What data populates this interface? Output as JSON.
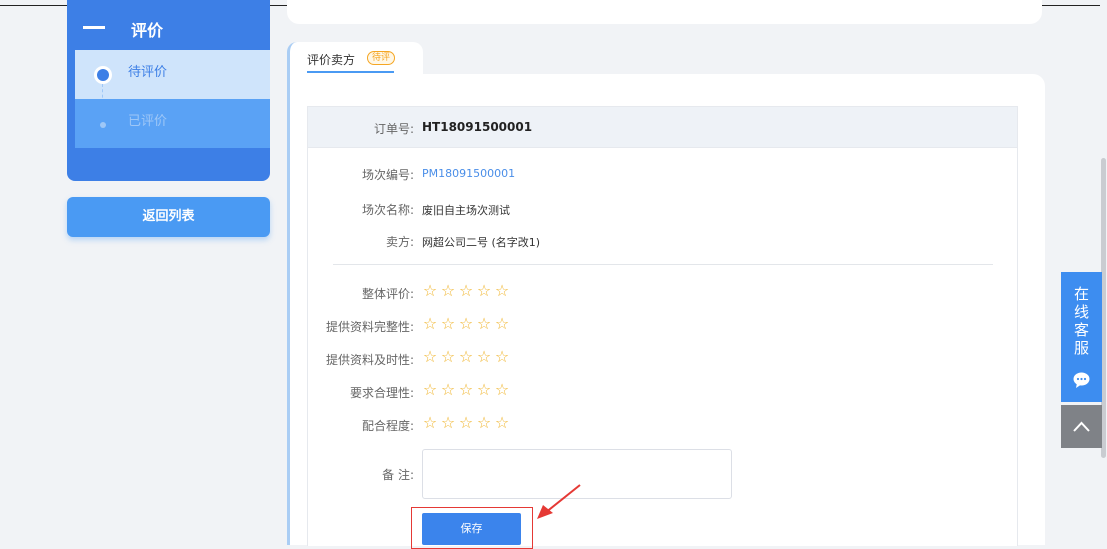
{
  "sidebar": {
    "title": "评价",
    "items": [
      {
        "label": "待评价",
        "active": true
      },
      {
        "label": "已评价",
        "active": false
      }
    ],
    "back_label": "返回列表"
  },
  "tab": {
    "label": "评价卖方",
    "badge": "待评"
  },
  "order": {
    "order_no_label": "订单号:",
    "order_no": "HT18091500001",
    "session_no_label": "场次编号:",
    "session_no": "PM18091500001",
    "session_name_label": "场次名称:",
    "session_name": "废旧自主场次测试",
    "seller_label": "卖方:",
    "seller": "网超公司二号 (名字改1)"
  },
  "ratings": [
    {
      "label": "整体评价:",
      "value": 0,
      "max": 5
    },
    {
      "label": "提供资料完整性:",
      "value": 0,
      "max": 5
    },
    {
      "label": "提供资料及时性:",
      "value": 0,
      "max": 5
    },
    {
      "label": "要求合理性:",
      "value": 0,
      "max": 5
    },
    {
      "label": "配合程度:",
      "value": 0,
      "max": 5
    }
  ],
  "remark": {
    "label": "备 注:",
    "value": ""
  },
  "save_label": "保存",
  "float_service": {
    "label": "在线客服"
  },
  "colors": {
    "primary": "#3d7fe6",
    "star": "#f0b630",
    "highlight": "#e53935"
  }
}
